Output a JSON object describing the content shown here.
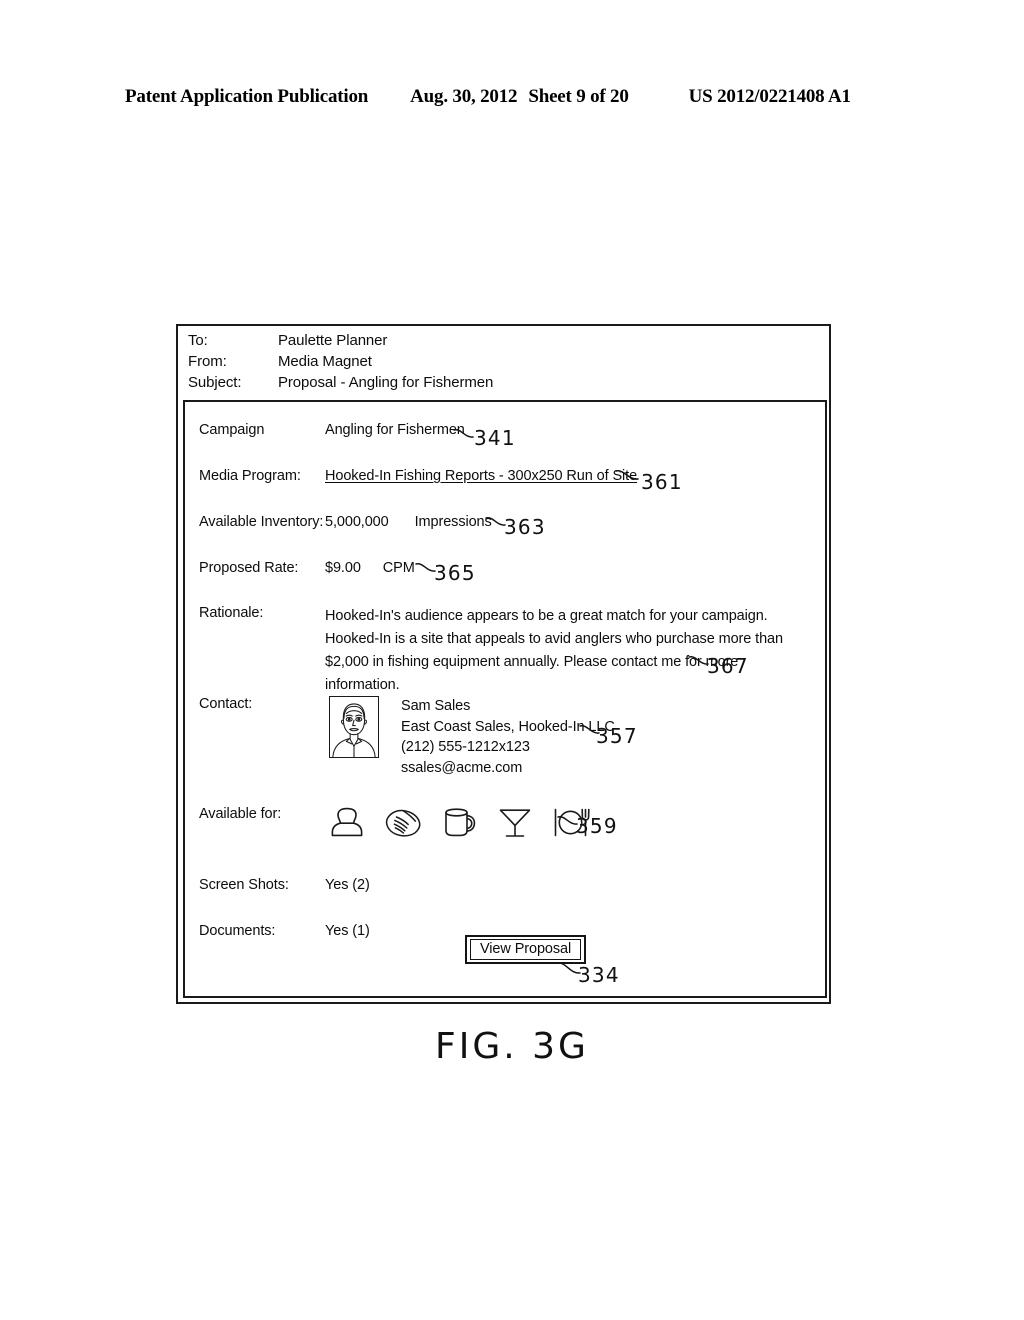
{
  "page_header": {
    "title": "Patent Application Publication",
    "date": "Aug. 30, 2012",
    "sheet": "Sheet 9 of 20",
    "publication_number": "US 2012/0221408 A1"
  },
  "figure": {
    "caption": "FIG. 3G"
  },
  "mail_header": {
    "to_label": "To:",
    "to_value": "Paulette Planner",
    "from_label": "From:",
    "from_value": "Media Magnet",
    "subject_label": "Subject:",
    "subject_value": "Proposal - Angling for Fishermen"
  },
  "fields": {
    "campaign_label": "Campaign",
    "campaign_value": "Angling for Fishermen",
    "media_program_label": "Media Program:",
    "media_program_value": "Hooked-In Fishing Reports - 300x250 Run of Site",
    "inventory_label": "Available Inventory:",
    "inventory_value": "5,000,000",
    "inventory_unit": "Impressions",
    "rate_label": "Proposed Rate:",
    "rate_value": "$9.00",
    "rate_unit": "CPM",
    "rationale_label": "Rationale:",
    "rationale_text": "Hooked-In's audience appears to be a great match for your campaign. Hooked-In is a site that appeals to avid anglers who purchase more than $2,000 in fishing equipment annually. Please contact me for more information.",
    "contact_label": "Contact:",
    "contact_name": "Sam Sales",
    "contact_company": "East Coast Sales, Hooked-In LLC",
    "contact_phone": "(212) 555-1212x123",
    "contact_email": "ssales@acme.com",
    "available_for_label": "Available for:",
    "screen_shots_label": "Screen Shots:",
    "screen_shots_value": "Yes (2)",
    "documents_label": "Documents:",
    "documents_value": "Yes (1)"
  },
  "availability_icons": [
    {
      "name": "telephone-icon",
      "meaning": "phone call"
    },
    {
      "name": "handshake-icon",
      "meaning": "meeting"
    },
    {
      "name": "coffee-mug-icon",
      "meaning": "coffee"
    },
    {
      "name": "martini-glass-icon",
      "meaning": "drinks"
    },
    {
      "name": "place-setting-icon",
      "meaning": "meal"
    }
  ],
  "button": {
    "view_proposal_label": "View Proposal"
  },
  "reference_numerals": {
    "campaign": "341",
    "media_program": "361",
    "inventory": "363",
    "rate": "365",
    "rationale": "367",
    "contact": "357",
    "available_for": "359",
    "view_proposal": "334"
  }
}
